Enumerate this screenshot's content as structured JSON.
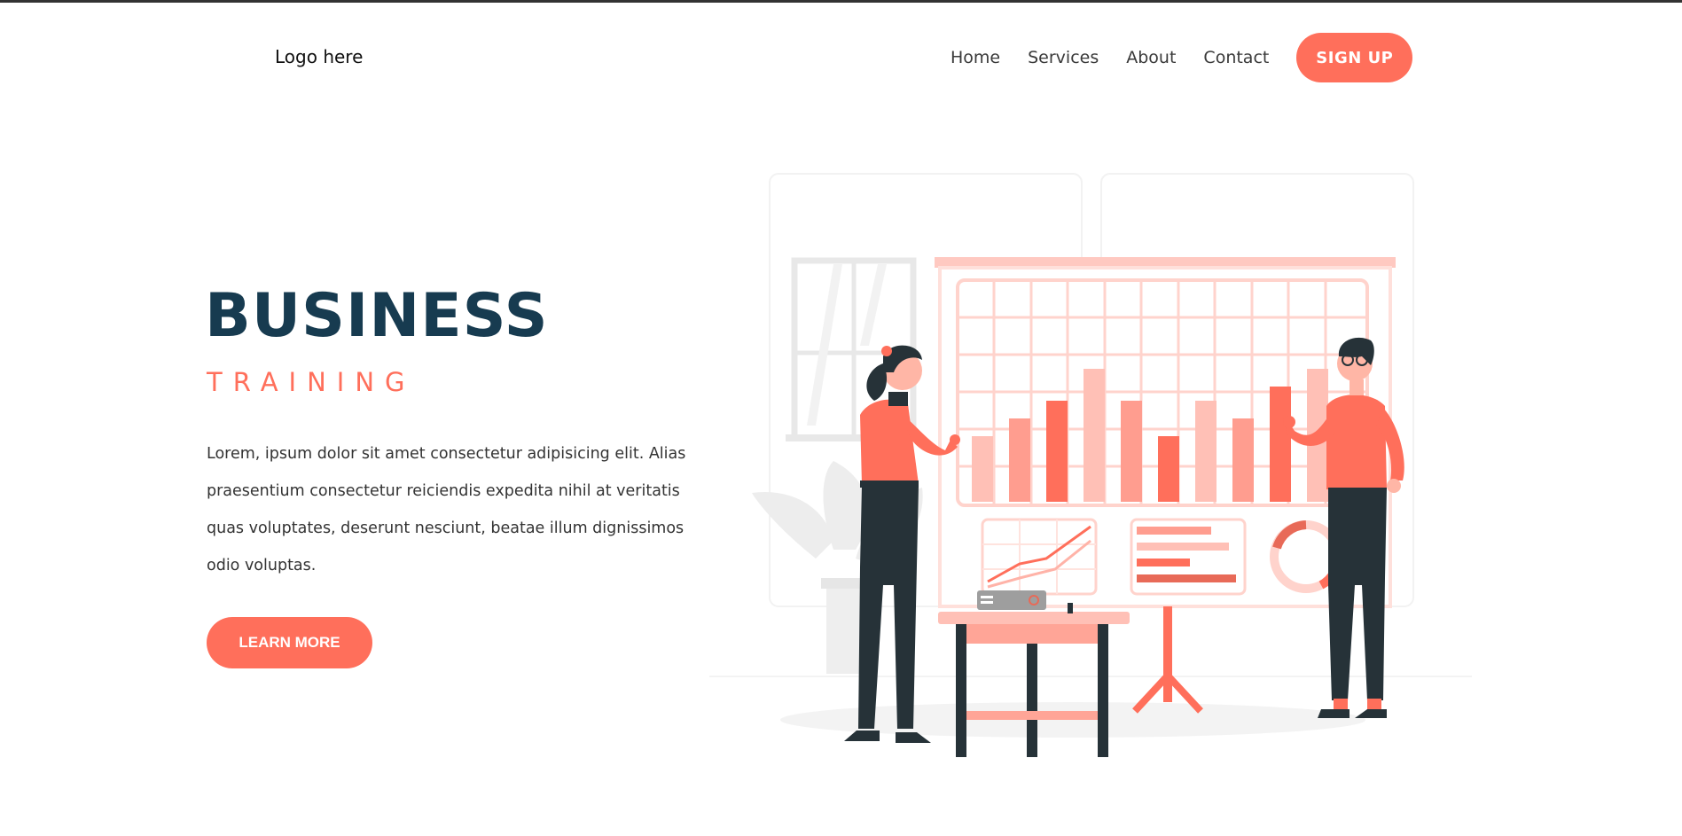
{
  "header": {
    "logo": "Logo here",
    "nav": [
      "Home",
      "Services",
      "About",
      "Contact"
    ],
    "signup_label": "SIGN UP"
  },
  "hero": {
    "title": "BUSINESS",
    "subtitle": "TRAINING",
    "text": "Lorem, ipsum dolor sit amet consectetur adipisicing elit. Alias praesentium consectetur reiciendis expedita nihil at veritatis quas voluptates, deserunt nesciunt, beatae illum dignissimos odio voluptas.",
    "cta_label": "LEARN MORE"
  },
  "colors": {
    "accent": "#ff6f5b",
    "heading": "#173b50",
    "dark": "#263238"
  }
}
